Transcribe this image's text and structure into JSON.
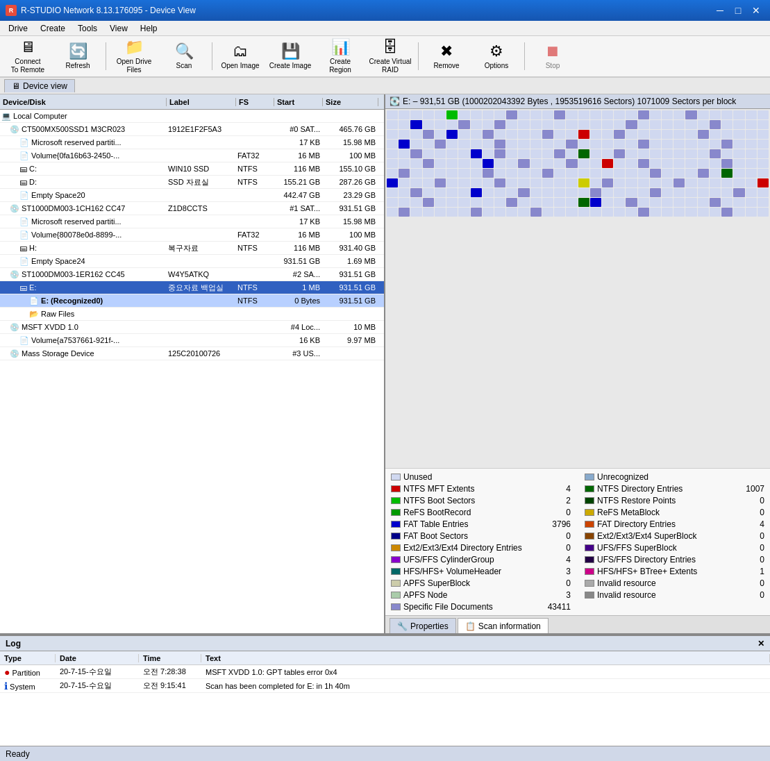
{
  "window": {
    "title": "R-STUDIO Network 8.13.176095 - Device View",
    "icon": "R"
  },
  "menubar": {
    "items": [
      "Drive",
      "Create",
      "Tools",
      "View",
      "Help"
    ]
  },
  "toolbar": {
    "buttons": [
      {
        "label": "Connect\nTo Remote",
        "icon": "🖥",
        "id": "connect",
        "disabled": false
      },
      {
        "label": "Refresh",
        "icon": "🔄",
        "id": "refresh",
        "disabled": false
      },
      {
        "label": "Open Drive Files",
        "icon": "📁",
        "id": "open-drive",
        "disabled": false
      },
      {
        "label": "Scan",
        "icon": "🔍",
        "id": "scan",
        "disabled": false
      },
      {
        "label": "Open Image",
        "icon": "🗂",
        "id": "open-image",
        "disabled": false
      },
      {
        "label": "Create Image",
        "icon": "💾",
        "id": "create-image",
        "disabled": false
      },
      {
        "label": "Create Region",
        "icon": "📊",
        "id": "create-region",
        "disabled": false
      },
      {
        "label": "Create Virtual RAID",
        "icon": "🗄",
        "id": "create-vraid",
        "disabled": false
      },
      {
        "label": "Remove",
        "icon": "✖",
        "id": "remove",
        "disabled": false
      },
      {
        "label": "Options",
        "icon": "⚙",
        "id": "options",
        "disabled": false
      },
      {
        "label": "Stop",
        "icon": "⏹",
        "id": "stop",
        "disabled": true
      }
    ]
  },
  "tab": {
    "label": "Device view"
  },
  "device_tree": {
    "columns": [
      "Device/Disk",
      "Label",
      "FS",
      "Start",
      "Size"
    ],
    "rows": [
      {
        "indent": 0,
        "icon": "computer",
        "name": "Local Computer",
        "label": "",
        "fs": "",
        "start": "",
        "size": ""
      },
      {
        "indent": 1,
        "icon": "disk",
        "name": "CT500MX500SSD1 M3CR023",
        "label": "1912E1F2F5A3",
        "fs": "",
        "start": "#0 SAT...",
        "size": "465.76 GB"
      },
      {
        "indent": 2,
        "icon": "part",
        "name": "Microsoft reserved partiti...",
        "label": "",
        "fs": "",
        "start": "17 KB",
        "size": "15.98 MB"
      },
      {
        "indent": 2,
        "icon": "part",
        "name": "Volume{0fa16b63-2450-...",
        "label": "",
        "fs": "FAT32",
        "start": "16 MB",
        "size": "100 MB"
      },
      {
        "indent": 2,
        "icon": "drive",
        "name": "C:",
        "label": "WIN10 SSD",
        "fs": "NTFS",
        "start": "116 MB",
        "size": "155.10 GB"
      },
      {
        "indent": 2,
        "icon": "drive",
        "name": "D:",
        "label": "SSD 자료실",
        "fs": "NTFS",
        "start": "155.21 GB",
        "size": "287.26 GB"
      },
      {
        "indent": 2,
        "icon": "part",
        "name": "Empty Space20",
        "label": "",
        "fs": "",
        "start": "442.47 GB",
        "size": "23.29 GB"
      },
      {
        "indent": 1,
        "icon": "disk",
        "name": "ST1000DM003-1CH162 CC47",
        "label": "Z1D8CCTS",
        "fs": "",
        "start": "#1 SAT...",
        "size": "931.51 GB"
      },
      {
        "indent": 2,
        "icon": "part",
        "name": "Microsoft reserved partiti...",
        "label": "",
        "fs": "",
        "start": "17 KB",
        "size": "15.98 MB"
      },
      {
        "indent": 2,
        "icon": "part",
        "name": "Volume{80078e0d-8899-...",
        "label": "",
        "fs": "FAT32",
        "start": "16 MB",
        "size": "100 MB"
      },
      {
        "indent": 2,
        "icon": "drive",
        "name": "H:",
        "label": "복구자료",
        "fs": "NTFS",
        "start": "116 MB",
        "size": "931.40 GB"
      },
      {
        "indent": 2,
        "icon": "part",
        "name": "Empty Space24",
        "label": "",
        "fs": "",
        "start": "931.51 GB",
        "size": "1.69 MB"
      },
      {
        "indent": 1,
        "icon": "disk",
        "name": "ST1000DM003-1ER162 CC45",
        "label": "W4Y5ATKQ",
        "fs": "",
        "start": "#2 SA...",
        "size": "931.51 GB"
      },
      {
        "indent": 2,
        "icon": "drive",
        "name": "E:",
        "label": "중요자료 백업실",
        "fs": "NTFS",
        "start": "1 MB",
        "size": "931.51 GB",
        "selected": true
      },
      {
        "indent": 3,
        "icon": "part",
        "name": "E: (Recognized0)",
        "label": "",
        "fs": "NTFS",
        "start": "0 Bytes",
        "size": "931.51 GB",
        "bold": true
      },
      {
        "indent": 3,
        "icon": "folder",
        "name": "Raw Files",
        "label": "",
        "fs": "",
        "start": "",
        "size": ""
      },
      {
        "indent": 1,
        "icon": "disk",
        "name": "MSFT XVDD 1.0",
        "label": "",
        "fs": "",
        "start": "#4 Loc...",
        "size": "10 MB"
      },
      {
        "indent": 2,
        "icon": "part",
        "name": "Volume{a7537661-921f-...",
        "label": "",
        "fs": "",
        "start": "16 KB",
        "size": "9.97 MB"
      },
      {
        "indent": 1,
        "icon": "disk",
        "name": "Mass Storage Device",
        "label": "125C20100726",
        "fs": "",
        "start": "#3 US...",
        "size": ""
      }
    ]
  },
  "disk_info": {
    "label": "E: – 931,51 GB (1000202043392 Bytes , 1953519616 Sectors) 1071009 Sectors per block"
  },
  "disk_map": {
    "colors": {
      "unused": "#d0d8f0",
      "ntfs_mft": "#cc0000",
      "ntfs_boot": "#00cc00",
      "refs_boot": "#009900",
      "fat_table": "#0000cc",
      "fat_boot": "#000088",
      "ext_dir": "#cc8800",
      "ufs_cyl": "#8800cc",
      "hfs_vol": "#006666",
      "apfs_super": "#ccccaa",
      "apfs_node": "#aaccaa",
      "spec_file": "#8888cc",
      "unrecognized": "#88aacc",
      "ntfs_dir": "#006600",
      "ntfs_restore": "#004400",
      "refs_meta": "#ccaa00",
      "fat_dir": "#cc4400",
      "ext34_super": "#884400",
      "ufs_super": "#440088",
      "ufs_dir": "#220044",
      "hfs_btree": "#cc0088",
      "invalid1": "#aaaaaa",
      "invalid2": "#888888"
    }
  },
  "legend": {
    "items_left": [
      {
        "color": "#d0d8f0",
        "label": "Unused",
        "count": ""
      },
      {
        "color": "#cc0000",
        "label": "NTFS MFT Extents",
        "count": "4"
      },
      {
        "color": "#00bb00",
        "label": "NTFS Boot Sectors",
        "count": "2"
      },
      {
        "color": "#009900",
        "label": "ReFS BootRecord",
        "count": "0"
      },
      {
        "color": "#0000cc",
        "label": "FAT Table Entries",
        "count": "3796"
      },
      {
        "color": "#000088",
        "label": "FAT Boot Sectors",
        "count": "0"
      },
      {
        "color": "#cc8800",
        "label": "Ext2/Ext3/Ext4 Directory Entries",
        "count": "0"
      },
      {
        "color": "#8800cc",
        "label": "UFS/FFS CylinderGroup",
        "count": "4"
      },
      {
        "color": "#006666",
        "label": "HFS/HFS+ VolumeHeader",
        "count": "3"
      },
      {
        "color": "#ccccaa",
        "label": "APFS SuperBlock",
        "count": "0"
      },
      {
        "color": "#aaccaa",
        "label": "APFS Node",
        "count": "3"
      },
      {
        "color": "#8888cc",
        "label": "Specific File Documents",
        "count": "43411"
      }
    ],
    "items_right": [
      {
        "color": "#88aacc",
        "label": "Unrecognized",
        "count": ""
      },
      {
        "color": "#006600",
        "label": "NTFS Directory Entries",
        "count": "1007"
      },
      {
        "color": "#004400",
        "label": "NTFS Restore Points",
        "count": "0"
      },
      {
        "color": "#ccaa00",
        "label": "ReFS MetaBlock",
        "count": "0"
      },
      {
        "color": "#cc4400",
        "label": "FAT Directory Entries",
        "count": "4"
      },
      {
        "color": "#884400",
        "label": "Ext2/Ext3/Ext4 SuperBlock",
        "count": "0"
      },
      {
        "color": "#440088",
        "label": "UFS/FFS SuperBlock",
        "count": "0"
      },
      {
        "color": "#220044",
        "label": "UFS/FFS Directory Entries",
        "count": "0"
      },
      {
        "color": "#cc0088",
        "label": "HFS/HFS+ BTree+ Extents",
        "count": "1"
      },
      {
        "color": "#aaaaaa",
        "label": "Invalid resource",
        "count": "0"
      },
      {
        "color": "#888888",
        "label": "Invalid resource",
        "count": "0"
      }
    ]
  },
  "panel_tabs": [
    {
      "label": "Properties",
      "icon": "🔧",
      "active": false
    },
    {
      "label": "Scan information",
      "icon": "📋",
      "active": true
    }
  ],
  "log": {
    "title": "Log",
    "columns": [
      "Type",
      "Date",
      "Time",
      "Text"
    ],
    "rows": [
      {
        "type": "Partition",
        "icon": "error",
        "date": "20-7-15-수요일",
        "time": "오전 7:28:38",
        "text": "MSFT XVDD 1.0: GPT tables error 0x4"
      },
      {
        "type": "System",
        "icon": "info",
        "date": "20-7-15-수요일",
        "time": "오전 9:15:41",
        "text": "Scan has been completed for E: in 1h 40m"
      }
    ]
  },
  "statusbar": {
    "text": "Ready"
  }
}
